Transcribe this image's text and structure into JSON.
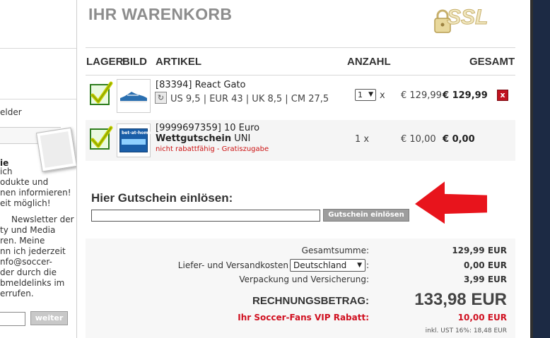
{
  "left": {
    "text_felder": "elder",
    "heading_fragment": "ie",
    "newsletter_lines": [
      "ich",
      "odukte und",
      "nen informieren!",
      "eit möglich!",
      "",
      "Newsletter der",
      "ty und Media",
      "ren. Meine",
      "nn ich jederzeit",
      "nfo@soccer-",
      "der durch die",
      "bmeldelinks im",
      "errufen."
    ],
    "submit_label": "weiter"
  },
  "cart": {
    "title": "IHR WARENKORB",
    "ssl_label": "SSL",
    "headers": {
      "lager": "LAGER",
      "bild": "BILD",
      "artikel": "ARTIKEL",
      "anzahl": "ANZAHL",
      "gesamt": "GESAMT"
    },
    "items": [
      {
        "name": "[83394] React Gato",
        "meta": "US 9,5 | EUR 43 | UK 8,5 | CM 27,5",
        "qty_selected": "1",
        "qty_suffix": "x",
        "unit_price": "€ 129,99",
        "total": "€ 129,99",
        "delete_icon": "x"
      },
      {
        "name_line1": "[9999697359] 10 Euro",
        "name_line2_bold": "Wettgutschein",
        "name_line2_rest": "UNI",
        "note": "nicht rabattfähig - Gratiszugabe",
        "qty_text": "1 x",
        "unit_price": "€ 10,00",
        "total": "€ 0,00",
        "thumb_label": "bet-at-home"
      }
    ]
  },
  "voucher": {
    "label": "Hier Gutschein einlösen:",
    "input_value": "",
    "button_label": "Gutschein einlösen"
  },
  "totals": {
    "sum_label": "Gesamtsumme:",
    "sum_value": "129,99 EUR",
    "shipping_label": "Liefer- und Versandkosten",
    "shipping_country": "Deutschland",
    "shipping_value": "0,00 EUR",
    "packaging_label": "Verpackung und Versicherung:",
    "packaging_value": "3,99 EUR",
    "grand_label": "RECHNUNGSBETRAG:",
    "grand_value": "133,98 EUR",
    "vip_label": "Ihr Soccer-Fans VIP Rabatt:",
    "vip_value": "10,00 EUR",
    "vat_text": "inkl. UST 16%: 18,48 EUR"
  },
  "colors": {
    "accent_red": "#d01020",
    "check_green": "#2e7d1e",
    "strip_dark": "#1c2a44"
  },
  "icons": [
    "check-icon",
    "delete-icon",
    "lock-icon",
    "red-arrow-icon",
    "reload-icon"
  ]
}
